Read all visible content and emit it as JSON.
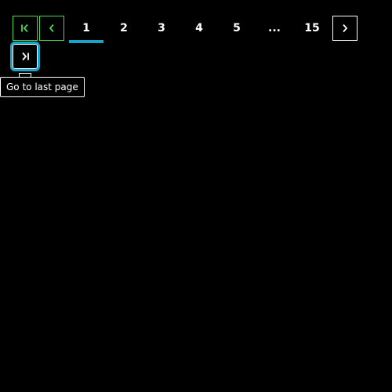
{
  "pagination": {
    "first_icon": "first-page-icon",
    "prev_icon": "chevron-left-icon",
    "next_icon": "chevron-right-icon",
    "last_icon": "last-page-icon",
    "pages": [
      "1",
      "2",
      "3",
      "4",
      "5",
      "...",
      "15"
    ],
    "current_page": "1",
    "disabled_color": "#4cd94c",
    "accent_color": "#1aa3c9"
  },
  "tooltip": {
    "text": "Go to last page"
  }
}
